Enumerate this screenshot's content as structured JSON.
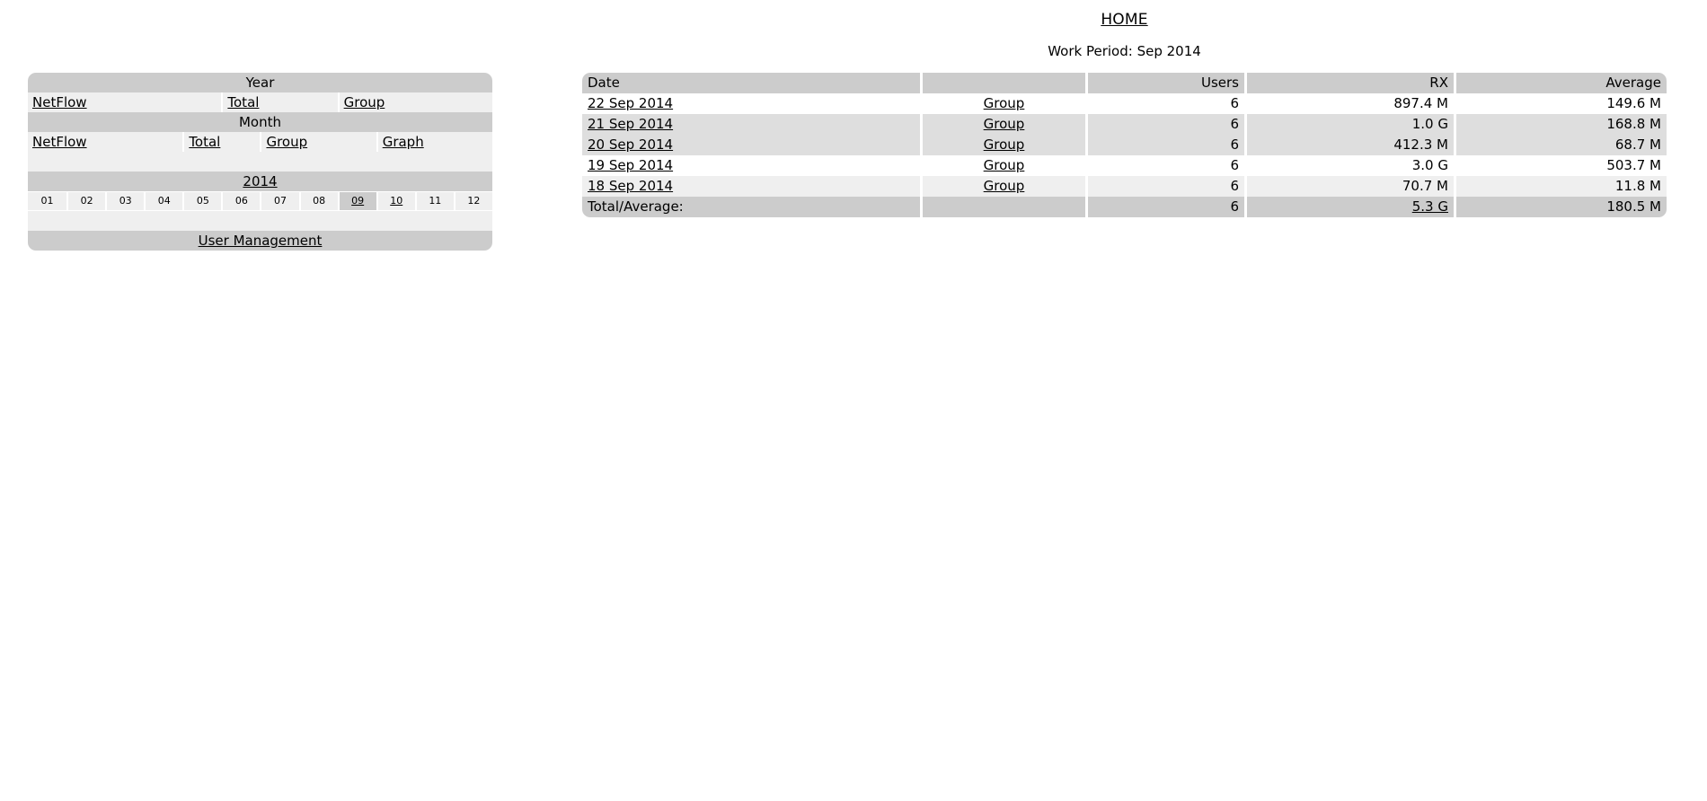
{
  "header": {
    "title": "HOME",
    "work_period": "Work Period: Sep 2014"
  },
  "nav": {
    "year_header": "Year",
    "year_links": [
      {
        "label": "NetFlow",
        "name": "year-netflow"
      },
      {
        "label": "Total",
        "name": "year-total"
      },
      {
        "label": "Group",
        "name": "year-group"
      }
    ],
    "month_header": "Month",
    "month_links": [
      {
        "label": "NetFlow",
        "name": "month-netflow"
      },
      {
        "label": "Total",
        "name": "month-total"
      },
      {
        "label": "Group",
        "name": "month-group"
      },
      {
        "label": "Graph",
        "name": "month-graph"
      }
    ],
    "year_value": "2014",
    "months": [
      {
        "label": "01",
        "state": "plain"
      },
      {
        "label": "02",
        "state": "plain"
      },
      {
        "label": "03",
        "state": "plain"
      },
      {
        "label": "04",
        "state": "plain"
      },
      {
        "label": "05",
        "state": "plain"
      },
      {
        "label": "06",
        "state": "plain"
      },
      {
        "label": "07",
        "state": "plain"
      },
      {
        "label": "08",
        "state": "plain"
      },
      {
        "label": "09",
        "state": "selected"
      },
      {
        "label": "10",
        "state": "link"
      },
      {
        "label": "11",
        "state": "plain"
      },
      {
        "label": "12",
        "state": "plain"
      }
    ],
    "user_management": "User Management"
  },
  "table": {
    "columns": [
      {
        "label": "Date",
        "align": "l"
      },
      {
        "label": "",
        "align": "c"
      },
      {
        "label": "Users",
        "align": "r"
      },
      {
        "label": "RX",
        "align": "r"
      },
      {
        "label": "Average",
        "align": "r"
      }
    ],
    "rows": [
      {
        "date": "22 Sep 2014",
        "group": "Group",
        "users": "6",
        "rx": "897.4 M",
        "average": "149.6 M"
      },
      {
        "date": "21 Sep 2014",
        "group": "Group",
        "users": "6",
        "rx": "1.0 G",
        "average": "168.8 M"
      },
      {
        "date": "20 Sep 2014",
        "group": "Group",
        "users": "6",
        "rx": "412.3 M",
        "average": "68.7 M"
      },
      {
        "date": "19 Sep 2014",
        "group": "Group",
        "users": "6",
        "rx": "3.0 G",
        "average": "503.7 M"
      },
      {
        "date": "18 Sep 2014",
        "group": "Group",
        "users": "6",
        "rx": "70.7 M",
        "average": "11.8 M"
      }
    ],
    "total": {
      "date": "Total/Average:",
      "group": "",
      "users": "6",
      "rx": "5.3 G",
      "average": "180.5 M"
    }
  },
  "colors": {
    "header_bg": "#cccccc",
    "light_bg": "#efefef",
    "mid_bg": "#dedede",
    "white_bg": "#ffffff",
    "text": "#000000"
  }
}
